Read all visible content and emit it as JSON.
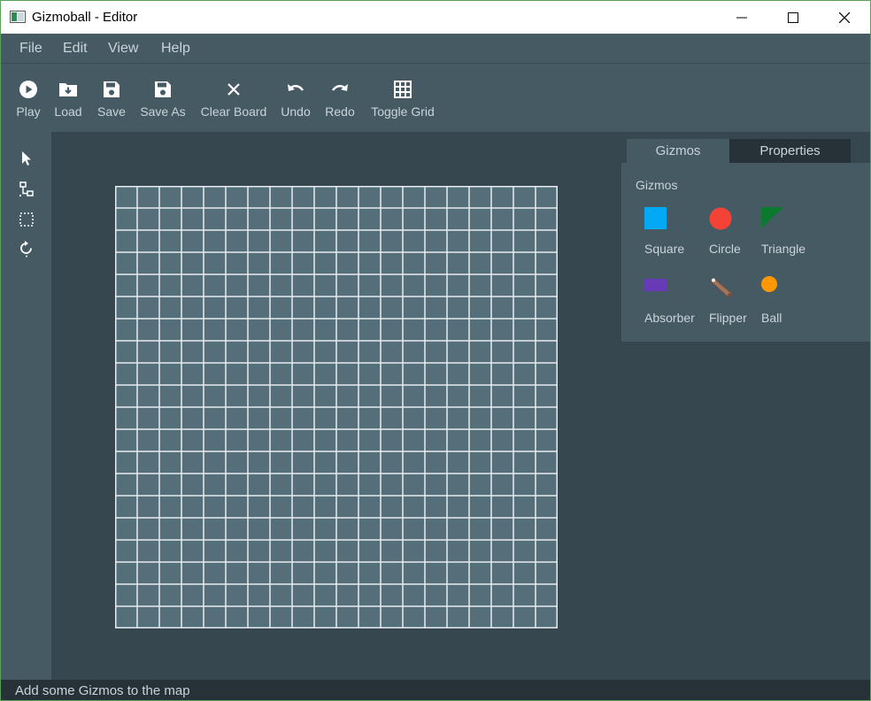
{
  "window": {
    "title": "Gizmoball - Editor"
  },
  "menu": {
    "items": [
      "File",
      "Edit",
      "View",
      "Help"
    ]
  },
  "toolbar": {
    "items": [
      {
        "label": "Play",
        "icon": "play-icon"
      },
      {
        "label": "Load",
        "icon": "folder-download-icon"
      },
      {
        "label": "Save",
        "icon": "floppy-icon"
      },
      {
        "label": "Save As",
        "icon": "floppy-icon"
      },
      {
        "label": "Clear Board",
        "icon": "close-icon"
      },
      {
        "label": "Undo",
        "icon": "undo-icon"
      },
      {
        "label": "Redo",
        "icon": "redo-icon"
      },
      {
        "label": "Toggle Grid",
        "icon": "grid-icon"
      }
    ]
  },
  "sidebar": {
    "tools": [
      "select-cursor-icon",
      "connect-icon",
      "marquee-select-icon",
      "rotate-icon"
    ]
  },
  "board": {
    "cells": 20
  },
  "panel": {
    "tabs": [
      "Gizmos",
      "Properties"
    ],
    "title": "Gizmos",
    "gizmos": [
      {
        "label": "Square",
        "icon": "square-icon",
        "color": "#03a9f4"
      },
      {
        "label": "Circle",
        "icon": "circle-icon",
        "color": "#f44336"
      },
      {
        "label": "Triangle",
        "icon": "triangle-icon",
        "color": "#0b7a2e"
      },
      {
        "label": "Absorber",
        "icon": "absorber-icon",
        "color": "#673ab7"
      },
      {
        "label": "Flipper",
        "icon": "flipper-icon",
        "color": "#a1765b"
      },
      {
        "label": "Ball",
        "icon": "ball-icon",
        "color": "#ff9800"
      }
    ]
  },
  "status": {
    "message": "Add some Gizmos to the map"
  },
  "colors": {
    "toolbar_bg": "#465a64",
    "workspace_bg": "#37474f",
    "board_bg": "#546e7a",
    "grid_line": "#e6ecef",
    "status_bg": "#263238"
  }
}
